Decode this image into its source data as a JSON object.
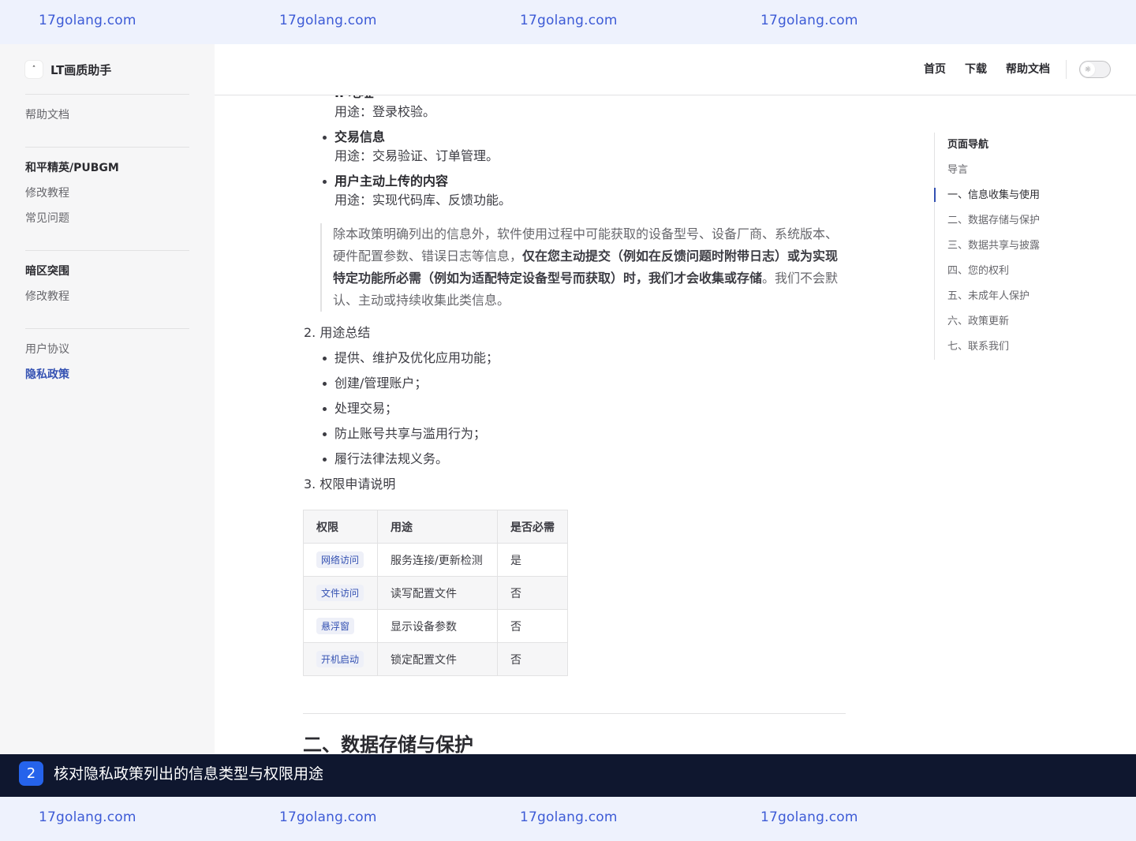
{
  "watermark": {
    "text": "17golang.com"
  },
  "sidebar": {
    "brand": {
      "logo_glyph": "˄",
      "name": "LT画质助手"
    },
    "help_docs": "帮助文档",
    "groups": [
      {
        "title": "和平精英/PUBGM",
        "items": [
          "修改教程",
          "常见问题"
        ]
      },
      {
        "title": "暗区突围",
        "items": [
          "修改教程"
        ]
      }
    ],
    "footer_items": [
      {
        "label": "用户协议",
        "active": false
      },
      {
        "label": "隐私政策",
        "active": true
      }
    ]
  },
  "nav": {
    "links": [
      "首页",
      "下载",
      "帮助文档"
    ],
    "theme_icon": "sun-icon",
    "theme_glyph": "☼"
  },
  "content": {
    "cut_heading": "IP地址",
    "list1": [
      {
        "sub": "用途：登录校验。"
      },
      {
        "title": "交易信息",
        "sub": "用途：交易验证、订单管理。"
      },
      {
        "title": "用户主动上传的内容",
        "sub": "用途：实现代码库、反馈功能。"
      }
    ],
    "quote": {
      "part1": "除本政策明确列出的信息外，软件使用过程中可能获取的设备型号、设备厂商、系统版本、硬件配置参数、错误日志等信息，",
      "bold": "仅在您主动提交（例如在反馈问题时附带日志）或为实现特定功能所必需（例如为适配特定设备型号而获取）时，我们才会收集或存储",
      "part2": "。我们不会默认、主动或持续收集此类信息。"
    },
    "section2": {
      "title": "2. 用途总结",
      "items": [
        "提供、维护及优化应用功能；",
        "创建/管理账户；",
        "处理交易；",
        "防止账号共享与滥用行为；",
        "履行法律法规义务。"
      ]
    },
    "section3": {
      "title": "3. 权限申请说明"
    },
    "table": {
      "headers": [
        "权限",
        "用途",
        "是否必需"
      ],
      "rows": [
        [
          "网络访问",
          "服务连接/更新检测",
          "是"
        ],
        [
          "文件访问",
          "读写配置文件",
          "否"
        ],
        [
          "悬浮窗",
          "显示设备参数",
          "否"
        ],
        [
          "开机启动",
          "锁定配置文件",
          "否"
        ]
      ]
    },
    "next_heading": "二、数据存储与保护"
  },
  "aside": {
    "title": "页面导航",
    "items": [
      "导言",
      "一、信息收集与使用",
      "二、数据存储与保护",
      "三、数据共享与披露",
      "四、您的权利",
      "五、未成年人保护",
      "六、政策更新",
      "七、联系我们"
    ],
    "active_index": 1
  },
  "caption": {
    "step": "2",
    "text": "核对隐私政策列出的信息类型与权限用途"
  }
}
